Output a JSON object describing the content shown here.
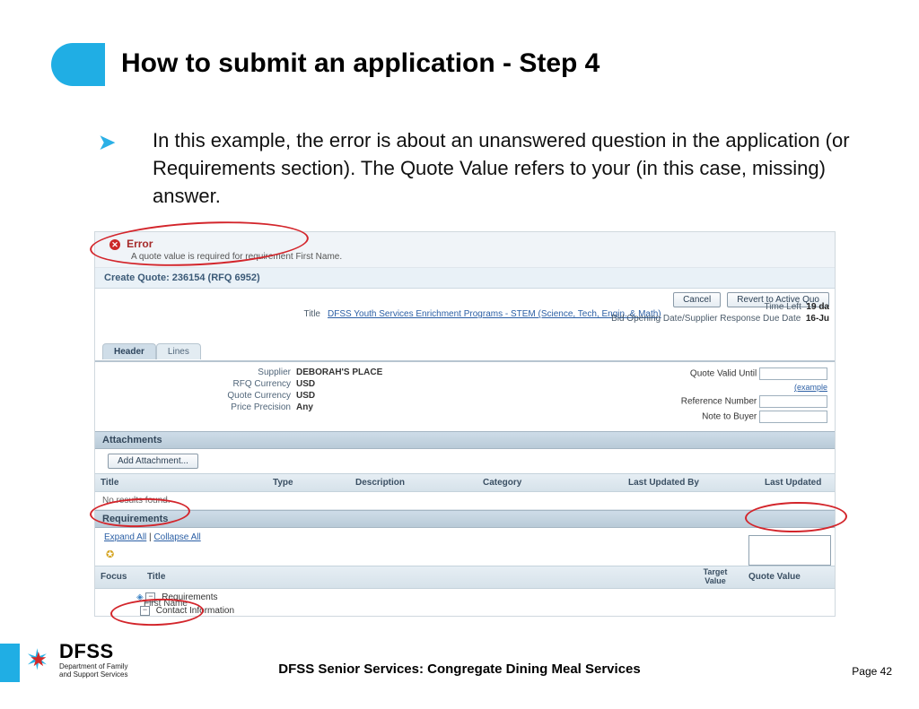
{
  "title": "How to submit an application - Step 4",
  "bullet": "In this example, the error is about an unanswered question in the application (or Requirements section). The Quote Value refers to your (in this case, missing) answer.",
  "shot": {
    "error": {
      "label": "Error",
      "message": "A quote value is required for requirement First Name."
    },
    "create_quote": "Create Quote: 236154 (RFQ 6952)",
    "buttons": {
      "cancel": "Cancel",
      "revert": "Revert to Active Quo"
    },
    "title_label": "Title",
    "title_link": "DFSS Youth Services Enrichment Programs - STEM (Science, Tech, Engin. & Math)",
    "meta": {
      "time_left_lbl": "Time Left",
      "time_left_val": "19 da",
      "due_lbl": "Bid Opening Date/Supplier Response Due Date",
      "due_val": "16-Ju"
    },
    "tabs": {
      "header": "Header",
      "lines": "Lines"
    },
    "fields": {
      "supplier_lbl": "Supplier",
      "supplier_val": "DEBORAH'S PLACE",
      "rfq_curr_lbl": "RFQ Currency",
      "rfq_curr_val": "USD",
      "quote_curr_lbl": "Quote Currency",
      "quote_curr_val": "USD",
      "price_prec_lbl": "Price Precision",
      "price_prec_val": "Any",
      "valid_until_lbl": "Quote Valid Until",
      "example": "(example",
      "ref_num_lbl": "Reference Number",
      "note_lbl": "Note to Buyer"
    },
    "sections": {
      "attachments": "Attachments",
      "requirements": "Requirements"
    },
    "add_attachment": "Add Attachment...",
    "attach_cols": {
      "title": "Title",
      "type": "Type",
      "desc": "Description",
      "cat": "Category",
      "upd": "Last Updated By",
      "date": "Last Updated"
    },
    "no_results": "No results found.",
    "expand": "Expand All",
    "collapse": "Collapse All",
    "req_cols": {
      "focus": "Focus",
      "title": "Title",
      "target": "Target Value",
      "quote": "Quote Value"
    },
    "tree": {
      "requirements": "Requirements",
      "contact_info": "Contact Information",
      "first_name": "First Name"
    }
  },
  "footer": {
    "logo_big": "DFSS",
    "logo_line1": "Department of Family",
    "logo_line2": "and Support Services",
    "center": "DFSS Senior Services: Congregate Dining Meal Services",
    "page": "Page 42"
  }
}
